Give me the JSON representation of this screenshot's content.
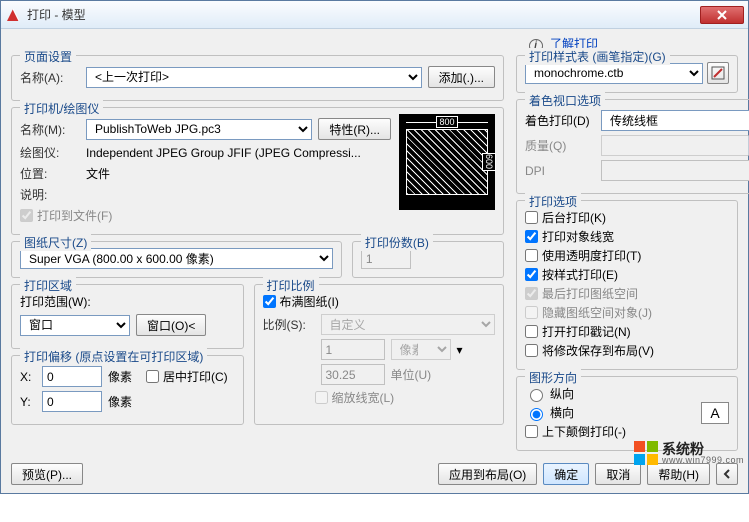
{
  "window": {
    "title": "打印 - 模型"
  },
  "toplink": {
    "label": "了解打印"
  },
  "page_setup": {
    "legend": "页面设置",
    "name_label": "名称(A):",
    "name_value": "<上一次打印>",
    "add_btn": "添加(.)..."
  },
  "printer": {
    "legend": "打印机/绘图仪",
    "name_label": "名称(M):",
    "name_value": "PublishToWeb JPG.pc3",
    "props_btn": "特性(R)...",
    "plotter_label": "绘图仪:",
    "plotter_value": "Independent JPEG Group JFIF (JPEG Compressi...",
    "where_label": "位置:",
    "where_value": "文件",
    "desc_label": "说明:",
    "to_file": "打印到文件(F)",
    "preview_w": "800",
    "preview_h": "600"
  },
  "paper": {
    "legend": "图纸尺寸(Z)",
    "value": "Super VGA (800.00 x 600.00 像素)",
    "copies_legend": "打印份数(B)",
    "copies_value": "1"
  },
  "area": {
    "legend": "打印区域",
    "what_label": "打印范围(W):",
    "what_value": "窗口",
    "window_btn": "窗口(O)<"
  },
  "offset": {
    "legend": "打印偏移 (原点设置在可打印区域)",
    "x_label": "X:",
    "x_value": "0",
    "x_unit": "像素",
    "y_label": "Y:",
    "y_value": "0",
    "y_unit": "像素",
    "center": "居中打印(C)"
  },
  "scale": {
    "legend": "打印比例",
    "fit": "布满图纸(I)",
    "ratio_label": "比例(S):",
    "ratio_value": "自定义",
    "num": "1",
    "num_unit": "像素",
    "den": "30.25",
    "den_unit": "单位(U)",
    "scale_lw": "缩放线宽(L)"
  },
  "style": {
    "legend": "打印样式表 (画笔指定)(G)",
    "value": "monochrome.ctb"
  },
  "viewport": {
    "legend": "着色视口选项",
    "shade_label": "着色打印(D)",
    "shade_value": "传统线框",
    "quality_label": "质量(Q)",
    "dpi_label": "DPI"
  },
  "options": {
    "legend": "打印选项",
    "bg": "后台打印(K)",
    "lw": "打印对象线宽",
    "trans": "使用透明度打印(T)",
    "styles": "按样式打印(E)",
    "last": "最后打印图纸空间",
    "hide": "隐藏图纸空间对象(J)",
    "stamp": "打开打印戳记(N)",
    "save": "将修改保存到布局(V)"
  },
  "orient": {
    "legend": "图形方向",
    "portrait": "纵向",
    "landscape": "横向",
    "upside": "上下颠倒打印(-)"
  },
  "footer": {
    "preview": "预览(P)...",
    "apply": "应用到布局(O)",
    "ok": "确定",
    "cancel": "取消",
    "help": "帮助(H)"
  },
  "watermark": {
    "line1": "系统粉",
    "line2": "www.win7999.com"
  }
}
